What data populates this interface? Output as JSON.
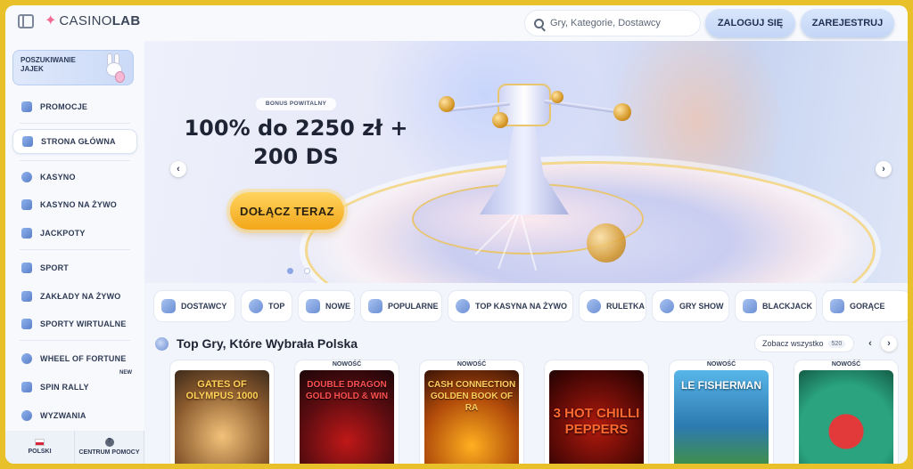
{
  "header": {
    "logo_prefix": "CASINO",
    "logo_suffix": "LAB",
    "search_placeholder": "Gry, Kategorie, Dostawcy",
    "login_label": "ZALOGUJ SIĘ",
    "register_label": "ZAREJESTRUJ"
  },
  "sidebar": {
    "promo_card": "POSZUKIWANIE JAJEK",
    "items": [
      {
        "label": "PROMOCJE"
      },
      {
        "label": "STRONA GŁÓWNA",
        "active": true
      },
      {
        "label": "KASYNO"
      },
      {
        "label": "KASYNO NA ŻYWO"
      },
      {
        "label": "JACKPOTY"
      },
      {
        "label": "SPORT"
      },
      {
        "label": "ZAKŁADY NA ŻYWO"
      },
      {
        "label": "SPORTY WIRTUALNE"
      },
      {
        "label": "WHEEL OF FORTUNE"
      },
      {
        "label": "SPIN RALLY",
        "badge": "NEW"
      },
      {
        "label": "WYZWANIA"
      }
    ],
    "footer": {
      "language": "POLSKI",
      "help": "CENTRUM POMOCY",
      "help_glyph": "?"
    }
  },
  "hero": {
    "bonus_tag": "BONUS POWITALNY",
    "title": "100% do 2250 zł + 200 DS",
    "cta": "DOŁĄCZ TERAZ",
    "prev_glyph": "‹",
    "next_glyph": "›",
    "slides_total": 2,
    "slide_active": 1
  },
  "categories": [
    {
      "label": "DOSTAWCY",
      "icon": "funnel-icon"
    },
    {
      "label": "TOP",
      "icon": "gear-icon"
    },
    {
      "label": "NOWE",
      "icon": "new-icon"
    },
    {
      "label": "POPULARNE",
      "icon": "star-icon"
    },
    {
      "label": "TOP KASYNA NA ŻYWO",
      "icon": "chip-icon"
    },
    {
      "label": "RULETKA",
      "icon": "roulette-icon"
    },
    {
      "label": "GRY SHOW",
      "icon": "show-icon"
    },
    {
      "label": "BLACKJACK",
      "icon": "cards-icon"
    },
    {
      "label": "GORĄCE",
      "icon": "fire-icon"
    }
  ],
  "section": {
    "title": "Top Gry, Które Wybrała Polska",
    "see_all": "Zobacz wszystko",
    "count": "520",
    "prev_glyph": "‹",
    "next_glyph": "›"
  },
  "games": [
    {
      "title": "GATES OF OLYMPUS 1000",
      "badge": "",
      "bg": "#6b4a2a",
      "fg": "#ffd35a"
    },
    {
      "title": "DOUBLE DRAGON GOLD HOLD & WIN",
      "badge": "NOWOŚĆ",
      "bg": "#2a0f12",
      "fg": "#ff4040"
    },
    {
      "title": "CASH CONNECTION GOLDEN BOOK OF RA",
      "badge": "NOWOŚĆ",
      "bg": "#3a1a0c",
      "fg": "#ffc840"
    },
    {
      "title": "3 HOT CHILLI PEPPERS",
      "badge": "",
      "bg": "#4a0a0a",
      "fg": "#ff5a2a"
    },
    {
      "title": "LE FISHERMAN",
      "badge": "NOWOŚĆ",
      "bg": "#2d7ab0",
      "fg": "#ffffff"
    },
    {
      "title": "",
      "badge": "NOWOŚĆ",
      "bg": "#1f8a6a",
      "fg": "#ffffff"
    }
  ]
}
